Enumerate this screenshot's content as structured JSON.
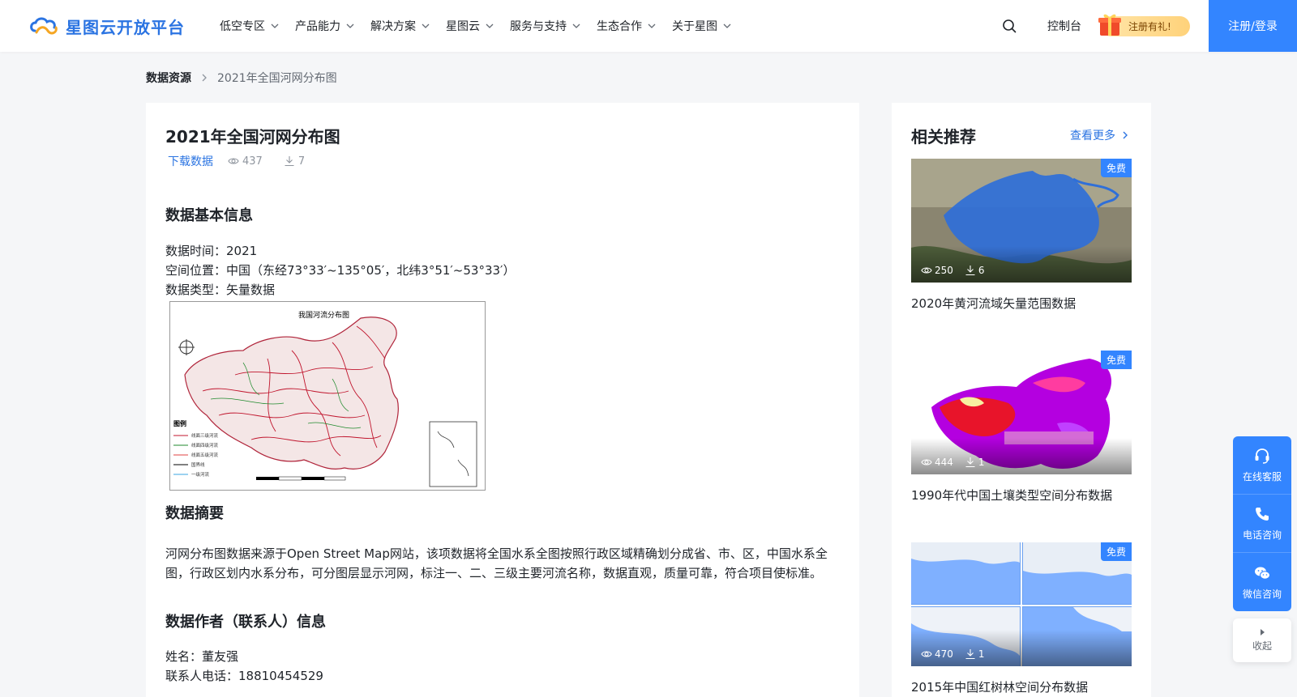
{
  "header": {
    "logo_text": "星图云开放平台",
    "nav": [
      {
        "label": "低空专区"
      },
      {
        "label": "产品能力"
      },
      {
        "label": "解决方案"
      },
      {
        "label": "星图云"
      },
      {
        "label": "服务与支持"
      },
      {
        "label": "生态合作"
      },
      {
        "label": "关于星图"
      }
    ],
    "console_label": "控制台",
    "gift_label": "注册有礼!",
    "login_label": "注册/登录"
  },
  "breadcrumb": {
    "root": "数据资源",
    "current": "2021年全国河网分布图"
  },
  "detail": {
    "title": "2021年全国河网分布图",
    "download_label": "下载数据",
    "views": "437",
    "downloads": "7",
    "basic_info_heading": "数据基本信息",
    "info_lines": [
      "数据时间：2021",
      "空间位置：中国（东经73°33′~135°05′，北纬3°51′~53°33′）",
      "数据类型：矢量数据"
    ],
    "map_title": "我国河流分布图",
    "map_legend_title": "图例",
    "map_legend_items": [
      "线面三级河流",
      "线面四级河流",
      "线面五级河流",
      "国界线",
      "一级河流"
    ],
    "abstract_heading": "数据摘要",
    "abstract_text": "河网分布图数据来源于Open Street Map网站，该项数据将全国水系全图按照行政区域精确划分成省、市、区，中国水系全图，行政区划内水系分布，可分图层显示河网，标注一、二、三级主要河流名称，数据直观，质量可靠，符合项目使标准。",
    "author_heading": "数据作者（联系人）信息",
    "author_lines": [
      "姓名：董友强",
      "联系人电话：18810454529"
    ]
  },
  "sidebar": {
    "title": "相关推荐",
    "more_label": "查看更多",
    "items": [
      {
        "name": "2020年黄河流域矢量范围数据",
        "badge": "免费",
        "views": "250",
        "downloads": "6"
      },
      {
        "name": "1990年代中国土壤类型空间分布数据",
        "badge": "免费",
        "views": "444",
        "downloads": "1"
      },
      {
        "name": "2015年中国红树林空间分布数据",
        "badge": "免费",
        "views": "470",
        "downloads": "1"
      }
    ]
  },
  "float": {
    "service_label": "在线客服",
    "phone_label": "电话咨询",
    "wechat_label": "微信咨询",
    "collapse_label": "收起"
  },
  "colors": {
    "accent": "#3385ff",
    "link": "#2b74e2",
    "background": "#f5f6f8"
  }
}
